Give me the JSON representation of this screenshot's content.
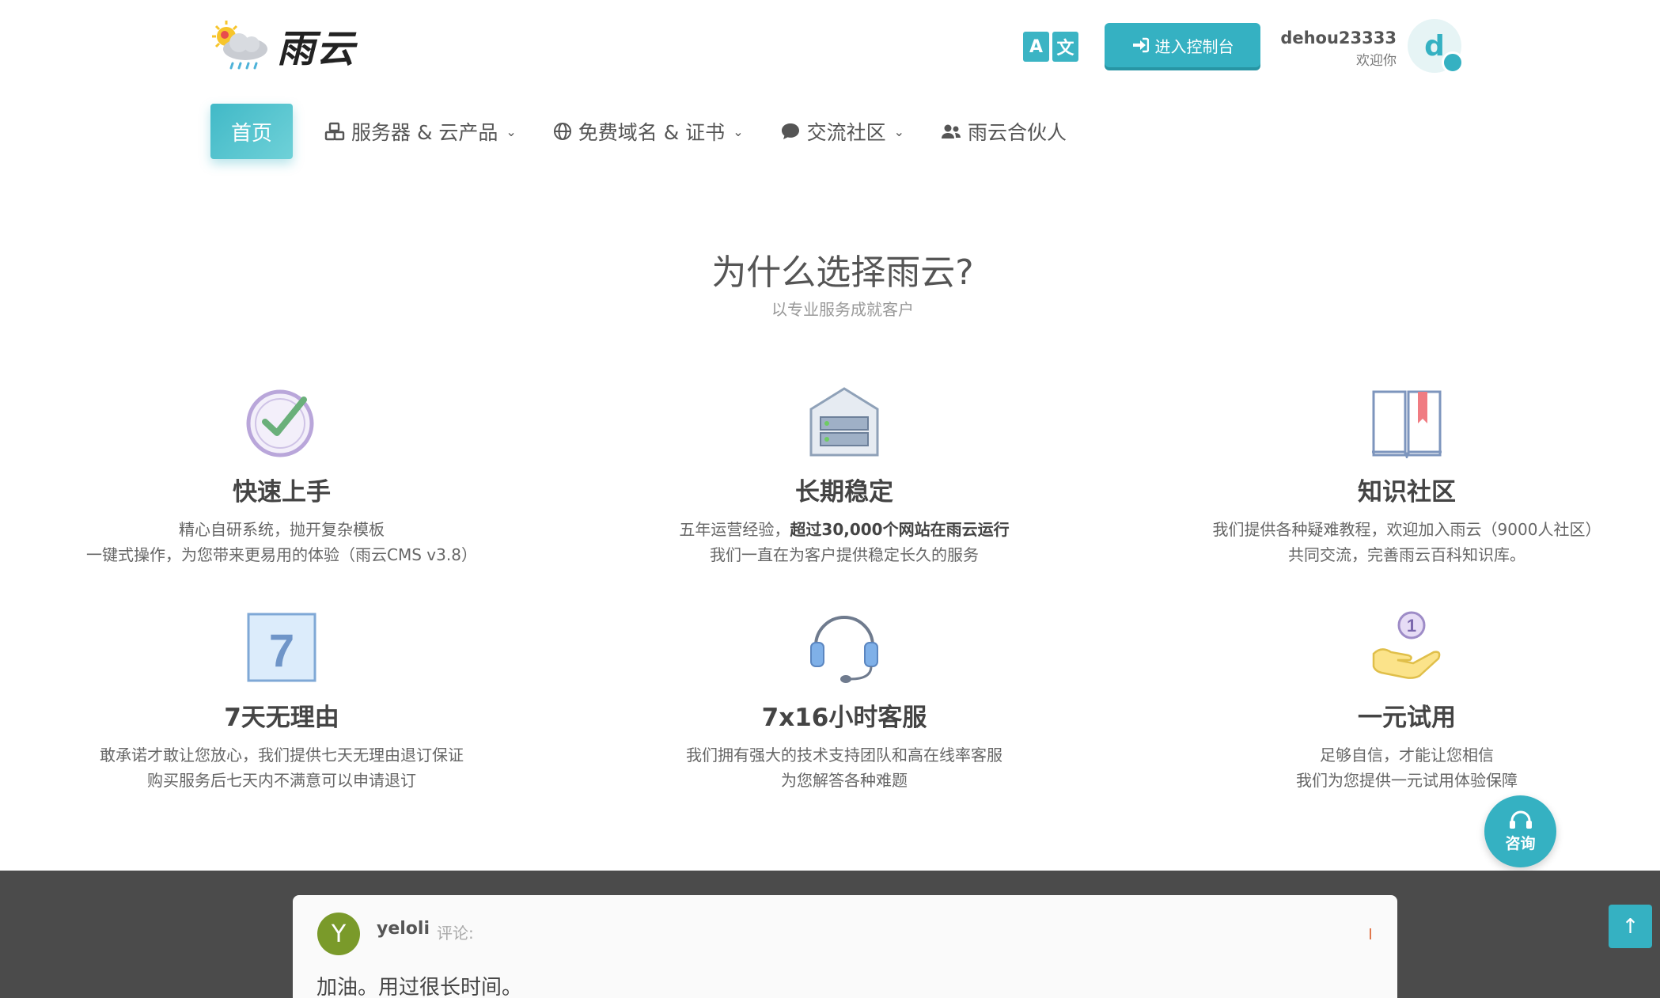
{
  "header": {
    "logo_text": "雨云",
    "translate": {
      "left": "A",
      "right": "文"
    },
    "console_label": "进入控制台",
    "user": {
      "name": "dehou23333",
      "welcome": "欢迎你",
      "avatar_letter": "d"
    }
  },
  "nav": {
    "home": "首页",
    "items": [
      {
        "label": "服务器 & 云产品",
        "icon": "cubes-icon",
        "dropdown": true
      },
      {
        "label": "免费域名 & 证书",
        "icon": "globe-icon",
        "dropdown": true
      },
      {
        "label": "交流社区",
        "icon": "comment-icon",
        "dropdown": true
      },
      {
        "label": "雨云合伙人",
        "icon": "users-icon",
        "dropdown": false
      }
    ]
  },
  "section": {
    "title": "为什么选择雨云?",
    "subtitle": "以专业服务成就客户"
  },
  "features": [
    {
      "title": "快速上手",
      "line1": "精心自研系统，抛开复杂模板",
      "line2": "一键式操作，为您带来更易用的体验（雨云CMS v3.8）",
      "icon": "check-clock-icon"
    },
    {
      "title": "长期稳定",
      "line1_prefix": "五年运营经验，",
      "line1_bold": "超过30,000个网站在雨云运行",
      "line2": "我们一直在为客户提供稳定长久的服务",
      "icon": "server-icon"
    },
    {
      "title": "知识社区",
      "line1": "我们提供各种疑难教程，欢迎加入雨云（9000人社区）",
      "line2": "共同交流，完善雨云百科知识库。",
      "icon": "book-icon"
    },
    {
      "title": "7天无理由",
      "line1": "敢承诺才敢让您放心，我们提供七天无理由退订保证",
      "line2": "购买服务后七天内不满意可以申请退订",
      "icon": "calendar-7-icon",
      "icon_text": "7"
    },
    {
      "title": "7x16小时客服",
      "line1": "我们拥有强大的技术支持团队和高在线率客服",
      "line2": "为您解答各种难题",
      "icon": "headset-icon"
    },
    {
      "title": "一元试用",
      "line1": "足够自信，才能让您相信",
      "line2": "我们为您提供一元试用体验保障",
      "icon": "hand-coin-icon",
      "icon_text": "1"
    }
  ],
  "consult_label": "咨询",
  "comment": {
    "avatar_letter": "Y",
    "name": "yeloli",
    "label": "评论:",
    "text": "加油。用过很长时间。"
  },
  "to_top": "↑",
  "colors": {
    "accent": "#35b1c2",
    "dark_band": "#4b4b4b"
  }
}
